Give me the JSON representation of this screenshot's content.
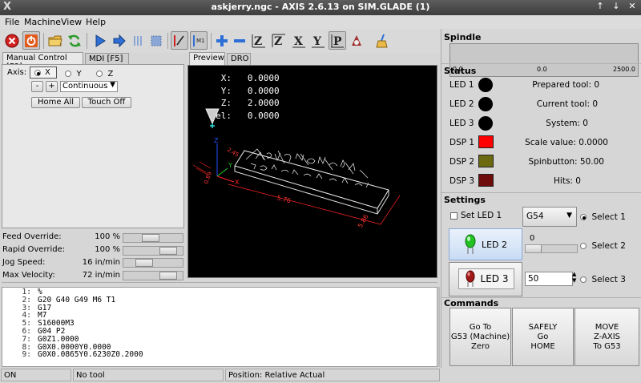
{
  "window": {
    "title": "askjerry.ngc - AXIS 2.6.13 on SIM.GLADE (1)",
    "logo": "X"
  },
  "menu": [
    "File",
    "Machine",
    "View",
    "Help"
  ],
  "toolbar_icons": [
    "estop-icon",
    "power-icon",
    "open-file-icon",
    "reload-icon",
    "run-icon",
    "step-icon",
    "pause-icon",
    "stop-icon",
    "block-delete-icon",
    "optional-stop-icon",
    "zoom-in-icon",
    "zoom-out-icon",
    "view-z-icon",
    "view-z2-icon",
    "view-x-icon",
    "view-y-icon",
    "view-p-icon",
    "rotate-icon",
    "clear-plot-icon"
  ],
  "tabs_left": [
    "Manual Control [F3]",
    "MDI [F5]"
  ],
  "manual": {
    "axis_label": "Axis:",
    "axes": [
      "X",
      "Y",
      "Z"
    ],
    "selected_axis": "X",
    "minus": "-",
    "plus": "+",
    "jog_mode": "Continuous",
    "home_all": "Home All",
    "touch_off": "Touch Off"
  },
  "overrides": [
    {
      "label": "Feed Override:",
      "value": "100 %",
      "level": 0.45
    },
    {
      "label": "Rapid Override:",
      "value": "100 %",
      "level": 0.9
    },
    {
      "label": "Jog Speed:",
      "value": "16 in/min",
      "level": 0.3
    },
    {
      "label": "Max Velocity:",
      "value": "72 in/min",
      "level": 0.9
    }
  ],
  "tabs_preview": [
    "Preview",
    "DRO"
  ],
  "dro": [
    {
      "axis": "X:",
      "value": "0.0000"
    },
    {
      "axis": "Y:",
      "value": "0.0000"
    },
    {
      "axis": "Z:",
      "value": "2.0000"
    },
    {
      "axis": "Vel:",
      "value": "0.0000"
    }
  ],
  "plot_labels": {
    "x_dim": "5.76",
    "y_dim": "5.86",
    "tick_a": "2.45",
    "tick_b": "0.89",
    "axis_z": "Z",
    "axis_y": "Y",
    "axis_x": "X"
  },
  "gcode": [
    {
      "n": "1:",
      "t": "%"
    },
    {
      "n": "2:",
      "t": "G20 G40 G49 M6 T1"
    },
    {
      "n": "3:",
      "t": "G17"
    },
    {
      "n": "4:",
      "t": "M7"
    },
    {
      "n": "5:",
      "t": "S16000M3"
    },
    {
      "n": "6:",
      "t": "G04 P2"
    },
    {
      "n": "7:",
      "t": "G0Z1.0000"
    },
    {
      "n": "8:",
      "t": "G0X0.0000Y0.0000"
    },
    {
      "n": "9:",
      "t": "G0X0.0865Y0.6230Z0.2000"
    }
  ],
  "statusbar": {
    "state": "ON",
    "tool": "No tool",
    "position": "Position: Relative Actual"
  },
  "spindle": {
    "title": "Spindle",
    "min": "0.0",
    "mid": "0.0",
    "max": "2500.0"
  },
  "status": {
    "title": "Status",
    "leds": [
      "LED 1",
      "LED 2",
      "LED 3"
    ],
    "dsps": [
      {
        "label": "DSP 1",
        "color": "#ff0000"
      },
      {
        "label": "DSP 2",
        "color": "#6b6a10"
      },
      {
        "label": "DSP 3",
        "color": "#6e0c0c"
      }
    ],
    "values": [
      "Prepared tool: 0",
      "Current tool: 0",
      "System: 0",
      "Scale value: 0.0000",
      "Spinbutton: 50.00",
      "Hits: 0"
    ]
  },
  "settings": {
    "title": "Settings",
    "set_led1": "Set LED 1",
    "coord_system": "G54",
    "select1": "Select 1",
    "select2": "Select 2",
    "select3": "Select 3",
    "led2_button": "LED 2",
    "led3_button": "LED 3",
    "hscale_value": "0",
    "spin_value": "50"
  },
  "commands": {
    "title": "Commands",
    "b1": [
      "Go To",
      "G53 (Machine)",
      "Zero"
    ],
    "b2": [
      "SAFELY",
      "Go",
      "HOME"
    ],
    "b3": [
      "MOVE",
      "Z-AXIS",
      "To G53"
    ]
  }
}
